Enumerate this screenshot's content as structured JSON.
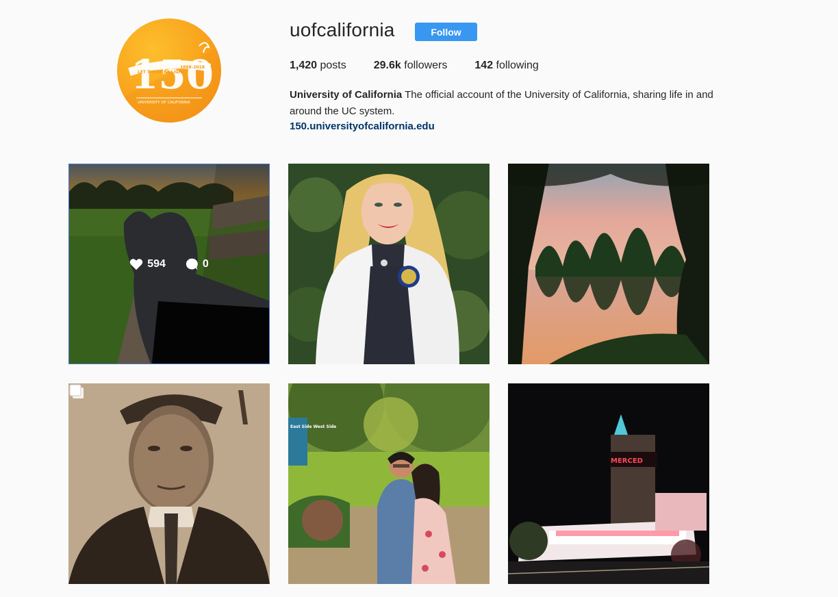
{
  "profile": {
    "username": "uofcalifornia",
    "follow_label": "Follow",
    "avatar_text": "150",
    "avatar_ribbon": "LET THERE BE LIGHT",
    "avatar_years": "1868-2018",
    "avatar_footer": "UNIVERSITY OF CALIFORNIA",
    "posts_count": "1,420",
    "posts_label": "posts",
    "followers_count": "29.6k",
    "followers_label": "followers",
    "following_count": "142",
    "following_label": "following",
    "full_name": "University of California",
    "bio": "The official account of the University of California, sharing life in and around the UC system.",
    "link": "150.universityofcalifornia.edu"
  },
  "posts": [
    {
      "subject": "cat on bench at sunset",
      "likes": "594",
      "comments": "0"
    },
    {
      "subject": "student in white coat"
    },
    {
      "subject": "trees reflected in pond at dusk"
    },
    {
      "subject": "vintage graduation portrait",
      "multi": true
    },
    {
      "subject": "couple hugging on campus lawn",
      "sign_text": "East Side West Side"
    },
    {
      "subject": "Merced theater at night",
      "sign_text": "MERCED"
    }
  ],
  "colors": {
    "accent": "#3897f0",
    "link": "#003569",
    "avatar": "#f8a21b"
  }
}
